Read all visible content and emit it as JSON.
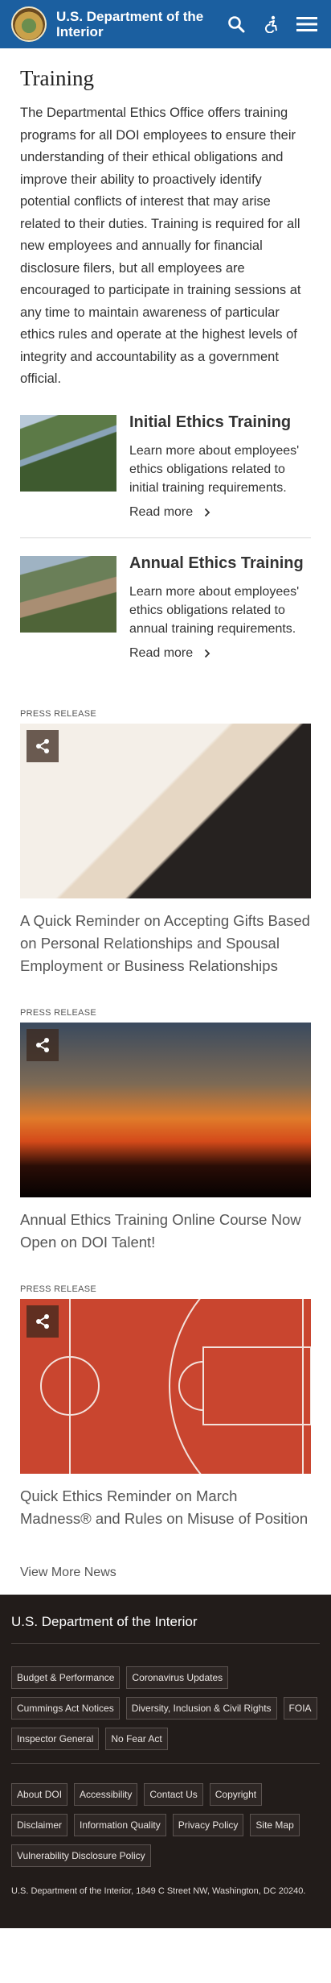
{
  "header": {
    "title_line1": "U.S. Department of the",
    "title_line2": "Interior"
  },
  "page": {
    "title": "Training",
    "intro": "The Departmental Ethics Office offers training programs for all DOI employees to ensure their understanding of their ethical obligations and improve their ability to proactively identify potential conflicts of interest that may arise related to their duties.  Training is required for all new employees and annually for financial disclosure filers, but all employees are encouraged to participate in training sessions at any time to maintain awareness of particular ethics rules and operate at the highest levels of integrity and accountability as a government official."
  },
  "cards": [
    {
      "title": "Initial Ethics Training",
      "text": "Learn more about employees' ethics obligations related to initial training requirements.",
      "link": "Read more"
    },
    {
      "title": "Annual Ethics Training",
      "text": "Learn more about employees' ethics obligations related to annual training requirements.",
      "link": "Read more"
    }
  ],
  "news": [
    {
      "kicker": "PRESS RELEASE",
      "title": "A Quick Reminder on Accepting Gifts Based on Personal Relationships and Spousal Employment or Business Relationships"
    },
    {
      "kicker": "PRESS RELEASE",
      "title": "Annual Ethics Training Online Course Now Open on DOI Talent!"
    },
    {
      "kicker": "PRESS RELEASE",
      "title": "Quick Ethics Reminder on March Madness® and Rules on Misuse of Position"
    }
  ],
  "view_more": "View More News",
  "footer": {
    "title": "U.S. Department of the Interior",
    "group1": [
      "Budget & Performance",
      "Coronavirus Updates",
      "Cummings Act Notices",
      "Diversity, Inclusion & Civil Rights",
      "FOIA",
      "Inspector General",
      "No Fear Act"
    ],
    "group2": [
      "About DOI",
      "Accessibility",
      "Contact Us",
      "Copyright",
      "Disclaimer",
      "Information Quality",
      "Privacy Policy",
      "Site Map",
      "Vulnerability Disclosure Policy"
    ],
    "address": "U.S. Department of the Interior, 1849 C Street NW, Washington, DC 20240."
  },
  "icons": {
    "logo": "doi-seal-icon",
    "search": "search-icon",
    "accessibility": "accessibility-icon",
    "menu": "menu-icon",
    "chevron": "chevron-right-icon",
    "share": "share-icon"
  },
  "colors": {
    "header_bg": "#1b5fa0",
    "footer_bg": "#221c1a"
  }
}
